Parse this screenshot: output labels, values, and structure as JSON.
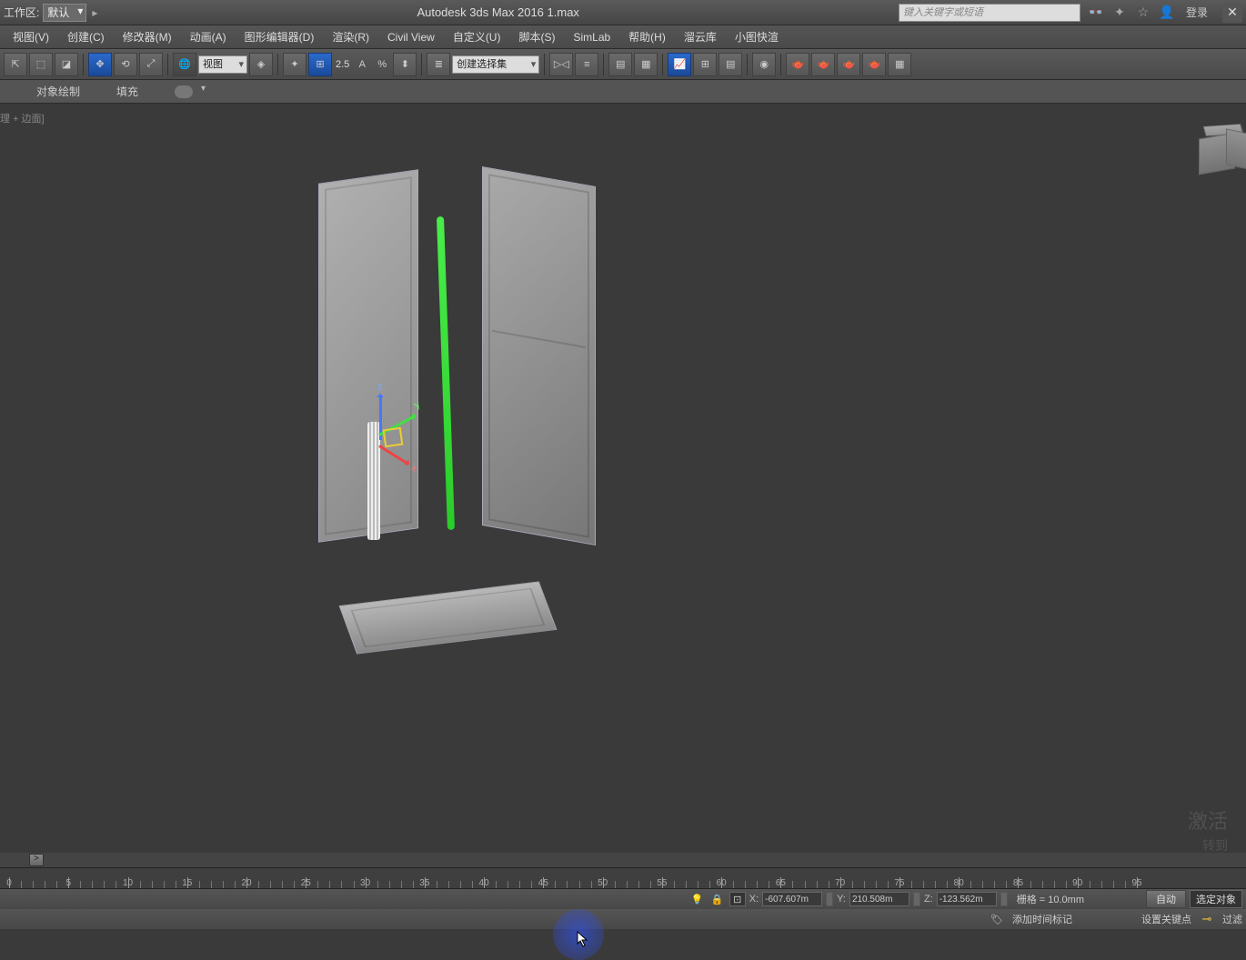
{
  "title_bar": {
    "workspace_label": "工作区:",
    "workspace_value": "默认",
    "app_title": "Autodesk 3ds Max 2016     1.max",
    "search_placeholder": "键入关键字或短语",
    "login": "登录"
  },
  "menu": {
    "items": [
      "视图(V)",
      "创建(C)",
      "修改器(M)",
      "动画(A)",
      "图形编辑器(D)",
      "渲染(R)",
      "Civil View",
      "自定义(U)",
      "脚本(S)",
      "SimLab",
      "帮助(H)",
      "溜云库",
      "小图快渲"
    ]
  },
  "toolbar": {
    "view_dd": "视图",
    "snap_val": "2.5",
    "angle_icon": "A",
    "percent_icon": "%",
    "selset_dd": "创建选择集"
  },
  "subbar": {
    "item1": "对象绘制",
    "item2": "填充"
  },
  "viewport": {
    "label": "理 + 边面]",
    "axes": {
      "x": "x",
      "y": "y",
      "z": "z"
    },
    "watermark1": "激活",
    "watermark2": "转到"
  },
  "ruler": {
    "ticks": [
      0,
      5,
      10,
      15,
      20,
      25,
      30,
      35,
      40,
      45,
      50,
      55,
      60,
      65,
      70,
      75,
      80,
      85,
      90,
      95
    ]
  },
  "status": {
    "x_label": "X:",
    "x_val": "-607.607m",
    "y_label": "Y:",
    "y_val": "210.508m",
    "z_label": "Z:",
    "z_val": "-123.562m",
    "grid": "栅格 = 10.0mm",
    "auto": "自动",
    "selected": "选定对象",
    "add_time": "添加时间标记",
    "set_key": "设置关键点",
    "filter": "过滤"
  }
}
